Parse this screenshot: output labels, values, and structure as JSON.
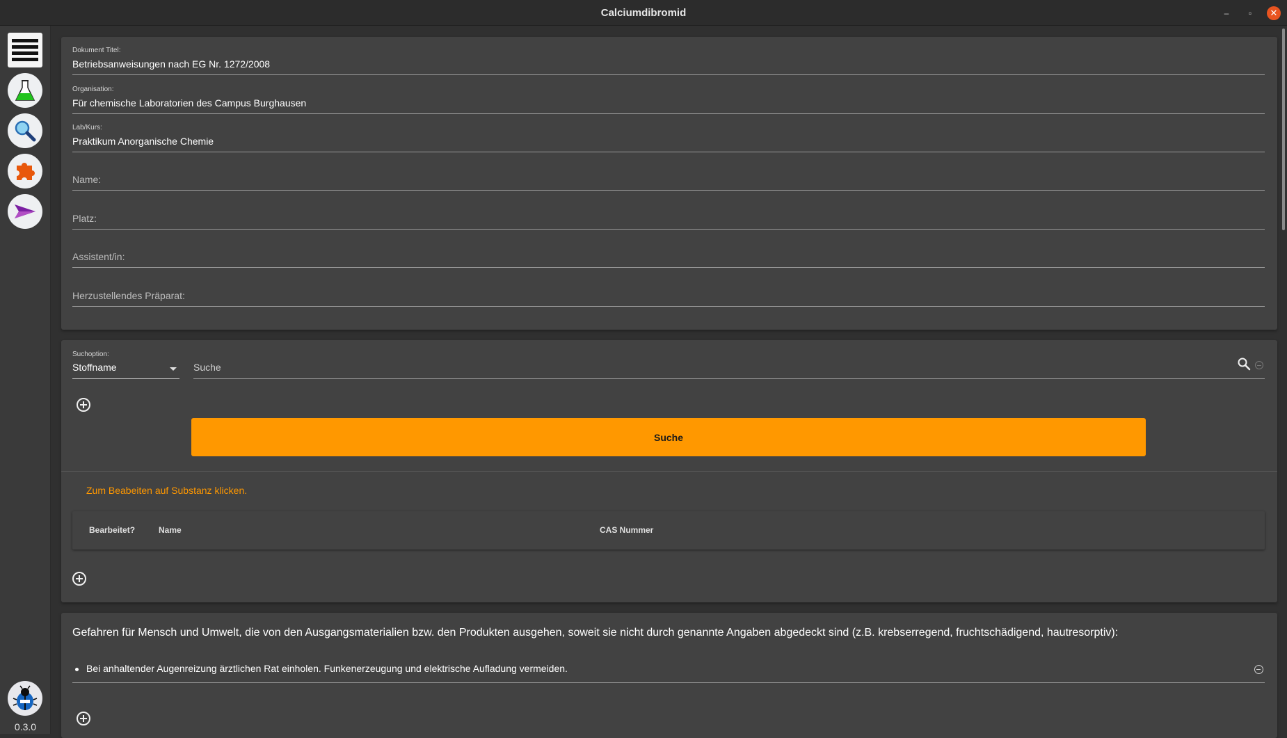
{
  "window": {
    "title": "Calciumdibromid",
    "minimize": "–",
    "maximize": "▫",
    "close": "✕"
  },
  "sidebar": {
    "items": [
      {
        "name": "menu",
        "icon": "hamburger-menu-icon"
      },
      {
        "name": "substances",
        "icon": "erlenmeyer-flask-icon"
      },
      {
        "name": "search",
        "icon": "magnifier-icon"
      },
      {
        "name": "plugins",
        "icon": "puzzle-piece-icon"
      },
      {
        "name": "export",
        "icon": "paper-plane-icon"
      }
    ],
    "bug_icon": "ladybug-icon",
    "version": "0.3.0"
  },
  "header_form": {
    "document_title": {
      "label": "Dokument Titel:",
      "value": "Betriebsanweisungen nach EG Nr. 1272/2008"
    },
    "organisation": {
      "label": "Organisation:",
      "value": "Für chemische Laboratorien des Campus Burghausen"
    },
    "lab_course": {
      "label": "Lab/Kurs:",
      "value": "Praktikum Anorganische Chemie"
    },
    "name": {
      "placeholder": "Name:"
    },
    "place": {
      "placeholder": "Platz:"
    },
    "assistant": {
      "placeholder": "Assistent/in:"
    },
    "preparation": {
      "placeholder": "Herzustellendes Präparat:"
    }
  },
  "search_panel": {
    "option_label": "Suchoption:",
    "option_value": "Stoffname",
    "search_placeholder": "Suche",
    "search_button": "Suche",
    "hint": "Zum Beabeiten auf Substanz klicken.",
    "table_headers": [
      "Bearbeitet?",
      "Name",
      "CAS Nummer"
    ]
  },
  "hazards": {
    "intro": "Gefahren für Mensch und Umwelt, die von den Ausgangsmaterialien bzw. den Produkten ausgehen, soweit sie nicht durch genannte Angaben abgedeckt sind (z.B. krebserregend, fruchtschädigend, hautresorptiv):",
    "items": [
      "Bei anhaltender Augenreizung ärztlichen Rat einholen. Funkenerzeugung und elektrische Aufladung vermeiden."
    ]
  },
  "colors": {
    "accent": "#ff9800",
    "panel": "#424242",
    "background": "#303030",
    "close": "#e95420"
  }
}
